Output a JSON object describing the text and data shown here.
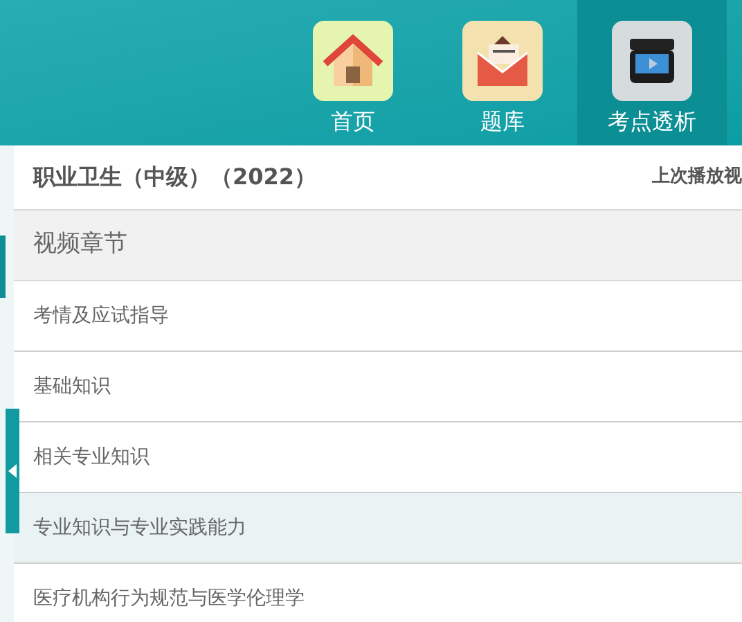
{
  "nav": [
    {
      "label": "首页",
      "kind": "home",
      "selected": false
    },
    {
      "label": "题库",
      "kind": "mail",
      "selected": false
    },
    {
      "label": "考点透析",
      "kind": "video",
      "selected": true
    }
  ],
  "course_title": "职业卫生（中级）（2022）",
  "last_played": "上次播放视",
  "section_header": "视频章节",
  "chapters": [
    {
      "label": "考情及应试指导",
      "selected": false
    },
    {
      "label": "基础知识",
      "selected": false
    },
    {
      "label": "相关专业知识",
      "selected": false
    },
    {
      "label": "专业知识与专业实践能力",
      "selected": true
    },
    {
      "label": "医疗机构行为规范与医学伦理学",
      "selected": false
    }
  ]
}
